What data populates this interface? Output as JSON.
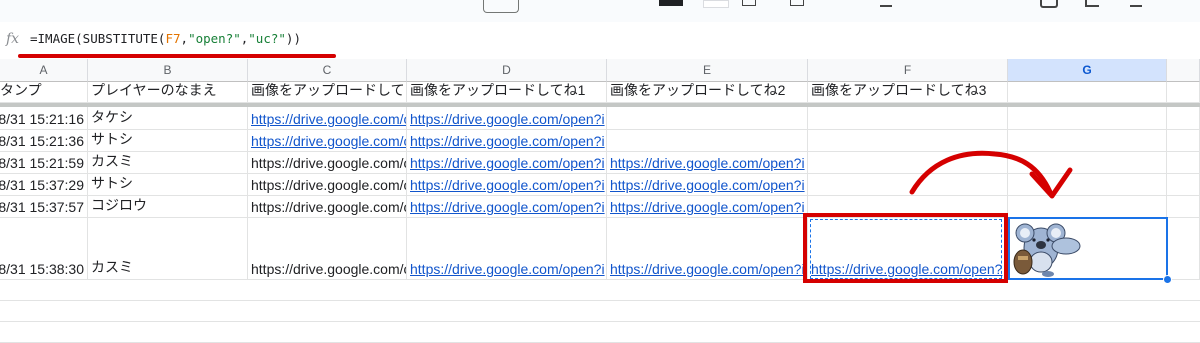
{
  "formula_bar": {
    "fx_label": "fx",
    "formula_prefix": "=IMAGE(SUBSTITUTE(",
    "formula_ref": "F7",
    "formula_comma1": ",",
    "formula_arg1": "\"open?\"",
    "formula_comma2": ",",
    "formula_arg2": "\"uc?\"",
    "formula_suffix": "))"
  },
  "columns": [
    "A",
    "B",
    "C",
    "D",
    "E",
    "F",
    "G"
  ],
  "header_row": {
    "a": "タンプ",
    "b": "プレイヤーのなまえ",
    "c": "画像をアップロードして",
    "d": "画像をアップロードしてね1",
    "e": "画像をアップロードしてね2",
    "f": "画像をアップロードしてね3"
  },
  "rows": [
    {
      "a": "8/31 15:21:16",
      "b": "タケシ",
      "c": "https://drive.google.com/o",
      "d": "https://drive.google.com/open?i",
      "e": "",
      "f": ""
    },
    {
      "a": "8/31 15:21:36",
      "b": "サトシ",
      "c": "https://drive.google.com/o",
      "d": "https://drive.google.com/open?i",
      "e": "",
      "f": ""
    },
    {
      "a": "8/31 15:21:59",
      "b": "カスミ",
      "c": "https://drive.google.com/o",
      "d": "https://drive.google.com/open?i",
      "e": "https://drive.google.com/open?i",
      "f": ""
    },
    {
      "a": "8/31 15:37:29",
      "b": "サトシ",
      "c": "https://drive.google.com/o",
      "d": "https://drive.google.com/open?i",
      "e": "https://drive.google.com/open?i",
      "f": ""
    },
    {
      "a": "8/31 15:37:57",
      "b": "コジロウ",
      "c": "https://drive.google.com/o",
      "d": "https://drive.google.com/open?i",
      "e": "https://drive.google.com/open?i",
      "f": ""
    },
    {
      "a": "8/31 15:38:30",
      "b": "カスミ",
      "c": "https://drive.google.com/o",
      "d": "https://drive.google.com/open?i",
      "e": "https://drive.google.com/open?i",
      "f": "https://drive.google.com/open?"
    }
  ],
  "colors": {
    "annotation_red": "#d50000",
    "selection_blue": "#1a73e8",
    "link_blue": "#1155cc"
  },
  "icons": [
    "koala-sticker-image",
    "annotation-arrow",
    "fx-icon"
  ]
}
